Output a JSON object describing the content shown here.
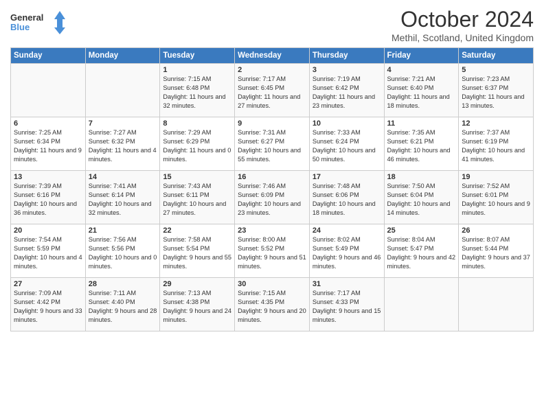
{
  "header": {
    "logo_line1": "General",
    "logo_line2": "Blue",
    "month": "October 2024",
    "location": "Methil, Scotland, United Kingdom"
  },
  "days_of_week": [
    "Sunday",
    "Monday",
    "Tuesday",
    "Wednesday",
    "Thursday",
    "Friday",
    "Saturday"
  ],
  "weeks": [
    [
      {
        "day": "",
        "info": ""
      },
      {
        "day": "",
        "info": ""
      },
      {
        "day": "1",
        "info": "Sunrise: 7:15 AM\nSunset: 6:48 PM\nDaylight: 11 hours and 32 minutes."
      },
      {
        "day": "2",
        "info": "Sunrise: 7:17 AM\nSunset: 6:45 PM\nDaylight: 11 hours and 27 minutes."
      },
      {
        "day": "3",
        "info": "Sunrise: 7:19 AM\nSunset: 6:42 PM\nDaylight: 11 hours and 23 minutes."
      },
      {
        "day": "4",
        "info": "Sunrise: 7:21 AM\nSunset: 6:40 PM\nDaylight: 11 hours and 18 minutes."
      },
      {
        "day": "5",
        "info": "Sunrise: 7:23 AM\nSunset: 6:37 PM\nDaylight: 11 hours and 13 minutes."
      }
    ],
    [
      {
        "day": "6",
        "info": "Sunrise: 7:25 AM\nSunset: 6:34 PM\nDaylight: 11 hours and 9 minutes."
      },
      {
        "day": "7",
        "info": "Sunrise: 7:27 AM\nSunset: 6:32 PM\nDaylight: 11 hours and 4 minutes."
      },
      {
        "day": "8",
        "info": "Sunrise: 7:29 AM\nSunset: 6:29 PM\nDaylight: 11 hours and 0 minutes."
      },
      {
        "day": "9",
        "info": "Sunrise: 7:31 AM\nSunset: 6:27 PM\nDaylight: 10 hours and 55 minutes."
      },
      {
        "day": "10",
        "info": "Sunrise: 7:33 AM\nSunset: 6:24 PM\nDaylight: 10 hours and 50 minutes."
      },
      {
        "day": "11",
        "info": "Sunrise: 7:35 AM\nSunset: 6:21 PM\nDaylight: 10 hours and 46 minutes."
      },
      {
        "day": "12",
        "info": "Sunrise: 7:37 AM\nSunset: 6:19 PM\nDaylight: 10 hours and 41 minutes."
      }
    ],
    [
      {
        "day": "13",
        "info": "Sunrise: 7:39 AM\nSunset: 6:16 PM\nDaylight: 10 hours and 36 minutes."
      },
      {
        "day": "14",
        "info": "Sunrise: 7:41 AM\nSunset: 6:14 PM\nDaylight: 10 hours and 32 minutes."
      },
      {
        "day": "15",
        "info": "Sunrise: 7:43 AM\nSunset: 6:11 PM\nDaylight: 10 hours and 27 minutes."
      },
      {
        "day": "16",
        "info": "Sunrise: 7:46 AM\nSunset: 6:09 PM\nDaylight: 10 hours and 23 minutes."
      },
      {
        "day": "17",
        "info": "Sunrise: 7:48 AM\nSunset: 6:06 PM\nDaylight: 10 hours and 18 minutes."
      },
      {
        "day": "18",
        "info": "Sunrise: 7:50 AM\nSunset: 6:04 PM\nDaylight: 10 hours and 14 minutes."
      },
      {
        "day": "19",
        "info": "Sunrise: 7:52 AM\nSunset: 6:01 PM\nDaylight: 10 hours and 9 minutes."
      }
    ],
    [
      {
        "day": "20",
        "info": "Sunrise: 7:54 AM\nSunset: 5:59 PM\nDaylight: 10 hours and 4 minutes."
      },
      {
        "day": "21",
        "info": "Sunrise: 7:56 AM\nSunset: 5:56 PM\nDaylight: 10 hours and 0 minutes."
      },
      {
        "day": "22",
        "info": "Sunrise: 7:58 AM\nSunset: 5:54 PM\nDaylight: 9 hours and 55 minutes."
      },
      {
        "day": "23",
        "info": "Sunrise: 8:00 AM\nSunset: 5:52 PM\nDaylight: 9 hours and 51 minutes."
      },
      {
        "day": "24",
        "info": "Sunrise: 8:02 AM\nSunset: 5:49 PM\nDaylight: 9 hours and 46 minutes."
      },
      {
        "day": "25",
        "info": "Sunrise: 8:04 AM\nSunset: 5:47 PM\nDaylight: 9 hours and 42 minutes."
      },
      {
        "day": "26",
        "info": "Sunrise: 8:07 AM\nSunset: 5:44 PM\nDaylight: 9 hours and 37 minutes."
      }
    ],
    [
      {
        "day": "27",
        "info": "Sunrise: 7:09 AM\nSunset: 4:42 PM\nDaylight: 9 hours and 33 minutes."
      },
      {
        "day": "28",
        "info": "Sunrise: 7:11 AM\nSunset: 4:40 PM\nDaylight: 9 hours and 28 minutes."
      },
      {
        "day": "29",
        "info": "Sunrise: 7:13 AM\nSunset: 4:38 PM\nDaylight: 9 hours and 24 minutes."
      },
      {
        "day": "30",
        "info": "Sunrise: 7:15 AM\nSunset: 4:35 PM\nDaylight: 9 hours and 20 minutes."
      },
      {
        "day": "31",
        "info": "Sunrise: 7:17 AM\nSunset: 4:33 PM\nDaylight: 9 hours and 15 minutes."
      },
      {
        "day": "",
        "info": ""
      },
      {
        "day": "",
        "info": ""
      }
    ]
  ]
}
